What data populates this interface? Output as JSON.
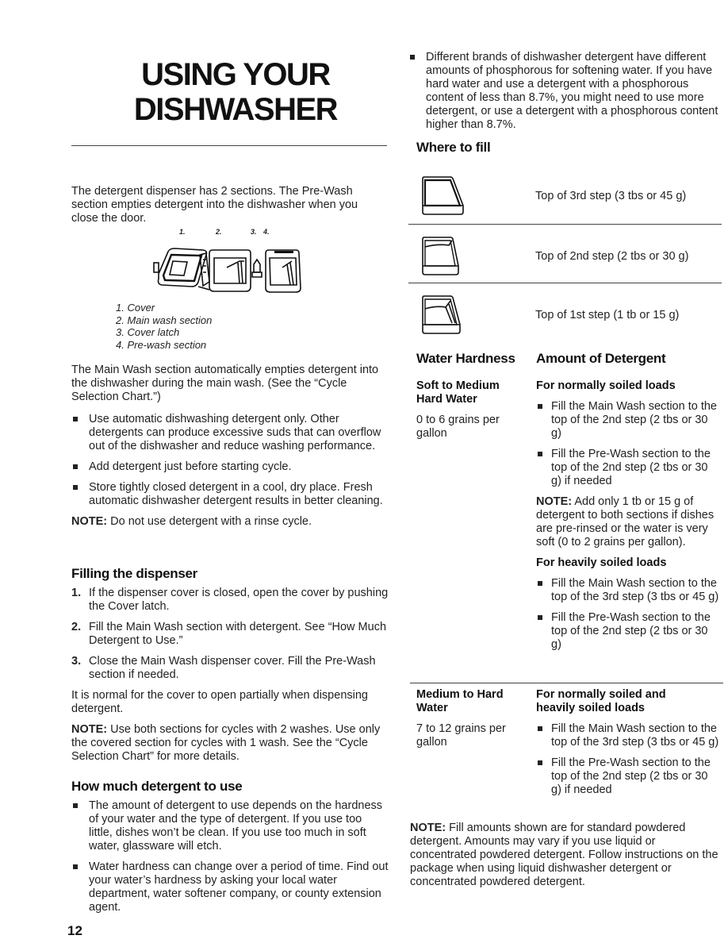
{
  "page_title_line1": "USING YOUR",
  "page_title_line2": "DISHWASHER",
  "intro": "The detergent dispenser has 2 sections. The Pre-Wash section empties detergent into the dishwasher when you close the door.",
  "diagram": {
    "callouts": [
      "1.",
      "2.",
      "3.",
      "4."
    ],
    "legend": [
      "1. Cover",
      "2. Main wash section",
      "3. Cover latch",
      "4. Pre-wash section"
    ]
  },
  "main_wash_para": "The Main Wash section automatically empties detergent into the dishwasher during the main wash. (See the “Cycle Selection Chart.”)",
  "usage_bullets": [
    "Use automatic dishwashing detergent only. Other detergents can produce excessive suds that can overflow out of the dishwasher and reduce washing performance.",
    "Add detergent just before starting cycle.",
    "Store tightly closed detergent in a cool, dry place. Fresh automatic dishwasher detergent results in better cleaning."
  ],
  "rinse_note": {
    "label": "NOTE:",
    "text": " Do not use detergent with a rinse cycle."
  },
  "filling": {
    "heading": "Filling the dispenser",
    "steps": [
      {
        "num": "1.",
        "text": "If the dispenser cover is closed, open the cover by pushing the Cover latch."
      },
      {
        "num": "2.",
        "text": "Fill the Main Wash section with detergent. See “How Much Detergent to Use.”"
      },
      {
        "num": "3.",
        "text": "Close the Main Wash dispenser cover. Fill the Pre-Wash section if needed."
      }
    ],
    "normal_para": "It is normal for the cover to open partially when dispensing detergent.",
    "note_label": "NOTE:",
    "note_text": " Use both sections for cycles with 2 washes. Use only the covered section for cycles with 1 wash. See the “Cycle Selection Chart” for more details."
  },
  "how_much": {
    "heading": "How much detergent to use",
    "bullets": [
      "The amount of detergent to use depends on the hardness of your water and the type of detergent. If you use too little, dishes won’t be clean. If you use too much in soft water, glassware will etch.",
      "Water hardness can change over a period of time. Find out your water’s hardness by asking your local water department, water softener company, or county extension agent.",
      "Different brands of dishwasher detergent have different amounts of phosphorous for softening water. If you have hard water and use a detergent with a phosphorous content of less than 8.7%, you might need to use more detergent, or use a detergent with a phosphorous content higher than 8.7%."
    ]
  },
  "where_to_fill": {
    "heading": "Where to fill",
    "rows": [
      {
        "icon": "cup-3rd-step-icon",
        "label": "Top of 3rd step (3 tbs or 45 g)"
      },
      {
        "icon": "cup-2nd-step-icon",
        "label": "Top of 2nd step (2 tbs or 30 g)"
      },
      {
        "icon": "cup-1st-step-icon",
        "label": "Top of 1st step (1 tb or 15 g)"
      }
    ]
  },
  "hardness_table": {
    "col1_header": "Water Hardness",
    "col2_header": "Amount of Detergent",
    "rows": [
      {
        "hardness": "Soft to Medium Hard Water",
        "grains": "0 to 6 grains per gallon",
        "normal_heading": "For normally soiled loads",
        "normal_bullets": [
          "Fill the Main Wash section to the top of the 2nd step (2 tbs or 30 g)",
          "Fill the Pre-Wash section to the top of the 2nd step (2 tbs or 30 g) if needed"
        ],
        "note_label": "NOTE:",
        "note_text": " Add only 1 tb or 15 g of detergent to both sections if dishes are pre-rinsed or the water is very soft (0 to 2 grains per gallon).",
        "heavy_heading": "For heavily soiled loads",
        "heavy_bullets": [
          "Fill the Main Wash section to the top of the 3rd step (3 tbs or 45 g)",
          "Fill the Pre-Wash section to the top of the 2nd step (2 tbs or 30 g)"
        ]
      },
      {
        "hardness": "Medium to Hard Water",
        "grains": "7 to 12 grains per gallon",
        "normal_heading": "For normally soiled and heavily soiled loads",
        "normal_bullets": [
          "Fill the Main Wash section to the top of the 3rd step (3 tbs or 45 g)",
          "Fill the Pre-Wash section to the top of the 2nd step (2 tbs or 30 g) if needed"
        ]
      }
    ]
  },
  "final_note": {
    "label": "NOTE:",
    "text": " Fill amounts shown are for standard powdered detergent. Amounts may vary if you use liquid or concentrated powdered detergent. Follow instructions on the package when using liquid dishwasher detergent or concentrated powdered detergent."
  },
  "page_number": "12"
}
